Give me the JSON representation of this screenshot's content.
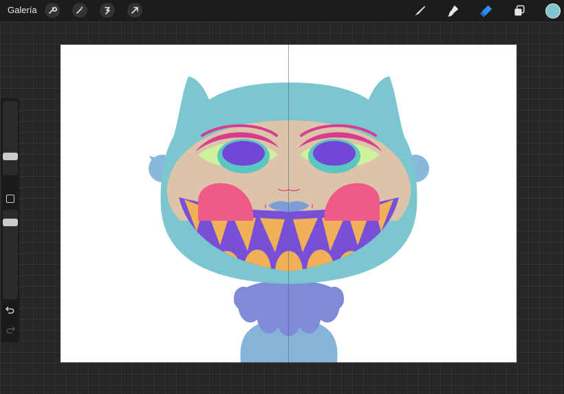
{
  "toolbar": {
    "gallery_label": "Galería",
    "left_tools": [
      "wrench-icon",
      "magic-wand-icon",
      "selection-icon",
      "transform-icon"
    ],
    "right_tools": [
      "brush-icon",
      "smudge-icon",
      "eraser-icon",
      "layers-icon"
    ],
    "active_tool": "eraser-icon",
    "current_color": "#7cc6cf"
  },
  "sidebar": {
    "brush_size_level": 0.18,
    "opacity_level": 0.15,
    "icons": [
      "modify-button",
      "undo-icon",
      "redo-icon"
    ]
  },
  "canvas": {
    "background": "#ffffff",
    "symmetry_guide": true,
    "palette": {
      "hood": "#7cc6cf",
      "face": "#dcc3a9",
      "mouth": "#7850d8",
      "teeth": "#f0b058",
      "cheeks": "#f05a88",
      "eyelids": "#d63d8c",
      "eye_white": "#ccf39c",
      "iris": "#7147d8",
      "iris_ring": "#5cc6c0",
      "lips": "#7f9ed8",
      "ears": "#88b8dc",
      "ruffle": "#7f8ad8",
      "body": "#86b4d8"
    }
  }
}
